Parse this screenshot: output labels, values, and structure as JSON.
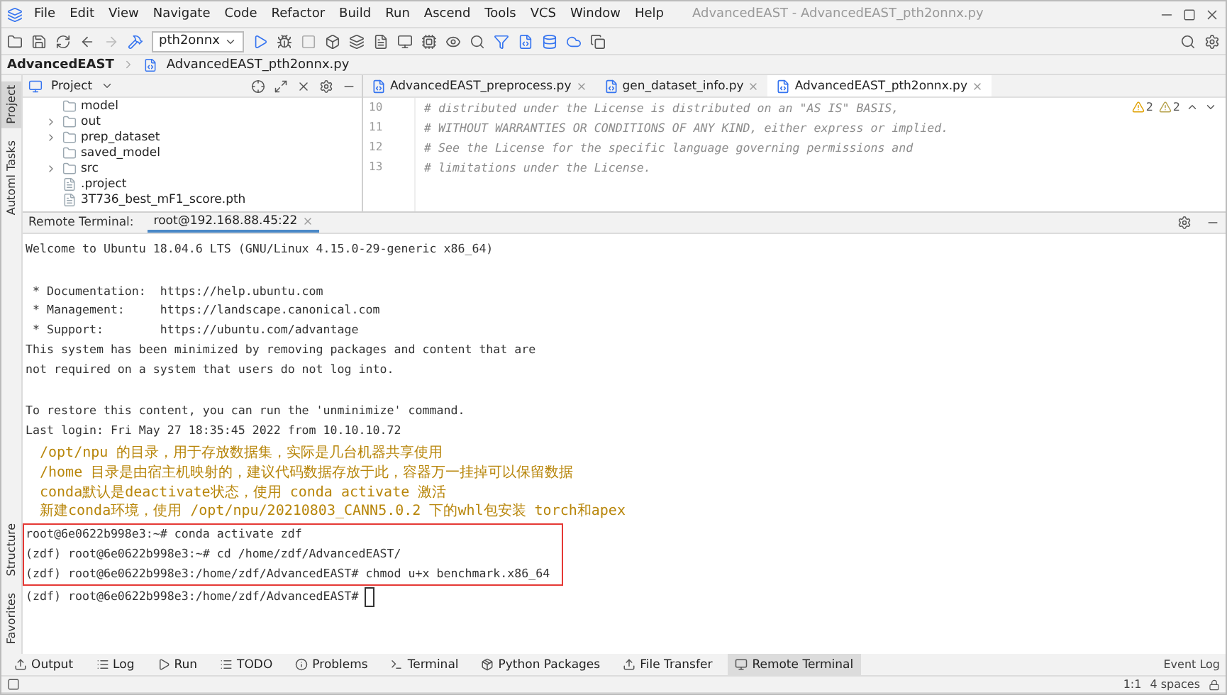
{
  "window": {
    "title": "AdvancedEAST - AdvancedEAST_pth2onnx.py"
  },
  "menu": [
    "File",
    "Edit",
    "View",
    "Navigate",
    "Code",
    "Refactor",
    "Build",
    "Run",
    "Ascend",
    "Tools",
    "VCS",
    "Window",
    "Help"
  ],
  "toolbar": {
    "run_config": "pth2onnx"
  },
  "breadcrumb": [
    {
      "label": "AdvancedEAST",
      "kind": "project"
    },
    {
      "label": "AdvancedEAST_pth2onnx.py",
      "kind": "file"
    }
  ],
  "left_strip": {
    "top": [
      {
        "label": "Project",
        "selected": true
      },
      {
        "label": "Automl Tasks",
        "selected": false
      }
    ],
    "bottom": [
      {
        "label": "Structure",
        "selected": false
      },
      {
        "label": "Favorites",
        "selected": false
      }
    ]
  },
  "project_panel": {
    "title": "Project",
    "items": [
      {
        "label": "model",
        "kind": "folder",
        "collapsible": false
      },
      {
        "label": "out",
        "kind": "folder",
        "collapsible": true
      },
      {
        "label": "prep_dataset",
        "kind": "folder",
        "collapsible": true
      },
      {
        "label": "saved_model",
        "kind": "folder",
        "collapsible": false
      },
      {
        "label": "src",
        "kind": "folder",
        "collapsible": true
      },
      {
        "label": ".project",
        "kind": "file",
        "collapsible": false
      },
      {
        "label": "3T736_best_mF1_score.pth",
        "kind": "file",
        "collapsible": false
      }
    ]
  },
  "editor": {
    "tabs": [
      {
        "label": "AdvancedEAST_preprocess.py",
        "selected": false
      },
      {
        "label": "gen_dataset_info.py",
        "selected": false
      },
      {
        "label": "AdvancedEAST_pth2onnx.py",
        "selected": true
      }
    ],
    "warnings": [
      "2",
      "2"
    ],
    "lines": [
      {
        "number": "10",
        "text": "# distributed under the License is distributed on an \"AS IS\" BASIS,"
      },
      {
        "number": "11",
        "text": "# WITHOUT WARRANTIES OR CONDITIONS OF ANY KIND, either express or implied."
      },
      {
        "number": "12",
        "text": "# See the License for the specific language governing permissions and"
      },
      {
        "number": "13",
        "text": "# limitations under the License."
      }
    ]
  },
  "terminal": {
    "label": "Remote Terminal:",
    "tab": "root@192.168.88.45:22",
    "blocks": [
      {
        "kind": "output",
        "lines": [
          "Welcome to Ubuntu 18.04.6 LTS (GNU/Linux 4.15.0-29-generic x86_64)"
        ]
      },
      {
        "kind": "output",
        "lines": [
          " * Documentation:  https://help.ubuntu.com",
          " * Management:     https://landscape.canonical.com",
          " * Support:        https://ubuntu.com/advantage",
          "This system has been minimized by removing packages and content that are",
          "not required on a system that users do not log into."
        ]
      },
      {
        "kind": "output",
        "lines": [
          "To restore this content, you can run the 'unminimize' command.",
          "Last login: Fri May 27 18:35:45 2022 from 10.10.10.72"
        ]
      },
      {
        "kind": "notice",
        "lines": [
          "/opt/npu 的目录，用于存放数据集，实际是几台机器共享使用",
          "/home 目录是由宿主机映射的，建议代码数据存放于此，容器万一挂掉可以保留数据",
          "conda默认是deactivate状态，使用 conda activate 激活",
          "新建conda环境，使用 /opt/npu/20210803_CANN5.0.2 下的whl包安装 torch和apex"
        ]
      },
      {
        "kind": "highlighted",
        "lines": [
          "root@6e0622b998e3:~# conda activate zdf",
          "(zdf) root@6e0622b998e3:~# cd /home/zdf/AdvancedEAST/",
          "(zdf) root@6e0622b998e3:/home/zdf/AdvancedEAST# chmod u+x benchmark.x86_64"
        ]
      },
      {
        "kind": "prompt",
        "lines": [
          "(zdf) root@6e0622b998e3:/home/zdf/AdvancedEAST#"
        ]
      }
    ]
  },
  "bottom_tabs": [
    {
      "label": "Output",
      "kind": "output",
      "selected": false
    },
    {
      "label": "Log",
      "kind": "log",
      "selected": false
    },
    {
      "label": "Run",
      "kind": "run",
      "selected": false
    },
    {
      "label": "TODO",
      "kind": "todo",
      "selected": false
    },
    {
      "label": "Problems",
      "kind": "problems",
      "selected": false
    },
    {
      "label": "Terminal",
      "kind": "terminal",
      "selected": false
    },
    {
      "label": "Python Packages",
      "kind": "packages",
      "selected": false
    },
    {
      "label": "File Transfer",
      "kind": "transfer",
      "selected": false
    },
    {
      "label": "Remote Terminal",
      "kind": "remote",
      "selected": true
    }
  ],
  "event_log": "Event Log",
  "status_bar": {
    "position": "1:1",
    "indent": "4 spaces"
  }
}
